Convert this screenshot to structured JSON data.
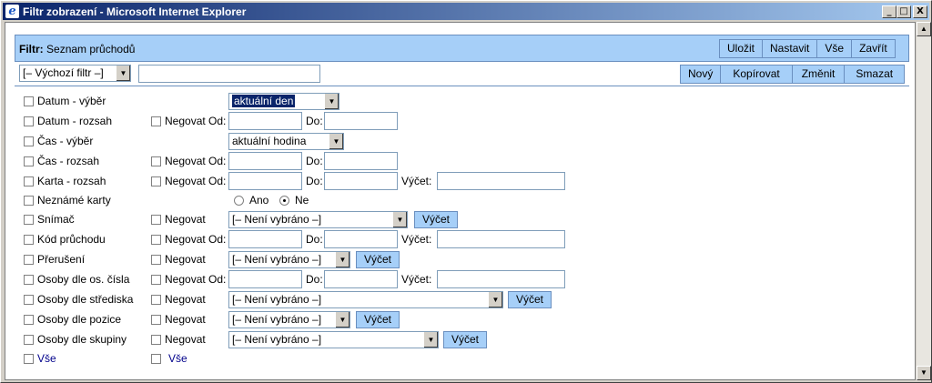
{
  "window": {
    "title": "Filtr zobrazení - Microsoft Internet Explorer",
    "icon_name": "ie-icon",
    "controls": [
      "_",
      "□",
      "X"
    ]
  },
  "header": {
    "prefix": "Filtr:",
    "title": "Seznam průchodů",
    "buttons": [
      "Uložit",
      "Nastavit",
      "Vše",
      "Zavřít"
    ]
  },
  "toolbar": {
    "filter_select": "[– Výchozí filtr –]",
    "filter_name_value": "",
    "buttons": [
      "Nový",
      "Kopírovat",
      "Změnit",
      "Smazat"
    ]
  },
  "labels": {
    "negovat": "Negovat",
    "negovat_od": "Negovat Od:",
    "do": "Do:",
    "vycet": "Výčet:",
    "vycet_button": "Výčet",
    "ano": "Ano",
    "ne": "Ne",
    "vse": "Vše"
  },
  "rows": [
    {
      "label": "Datum - výběr",
      "select": "aktuální den"
    },
    {
      "label": "Datum - rozsah"
    },
    {
      "label": "Čas - výběr",
      "select": "aktuální hodina"
    },
    {
      "label": "Čas - rozsah"
    },
    {
      "label": "Karta - rozsah"
    },
    {
      "label": "Neznámé karty",
      "radio_selected": "Ne"
    },
    {
      "label": "Snímač",
      "select": "[– Není vybráno –]"
    },
    {
      "label": "Kód průchodu"
    },
    {
      "label": "Přerušení",
      "select": "[– Není vybráno –]"
    },
    {
      "label": "Osoby dle os. čísla"
    },
    {
      "label": "Osoby dle střediska",
      "select": "[– Není vybráno –]"
    },
    {
      "label": "Osoby dle pozice",
      "select": "[– Není vybráno –]"
    },
    {
      "label": "Osoby dle skupiny",
      "select": "[– Není vybráno –]"
    }
  ],
  "colors": {
    "header_bg": "#a6cff8",
    "title_bar_start": "#0a246a",
    "title_bar_end": "#a6caf0"
  }
}
